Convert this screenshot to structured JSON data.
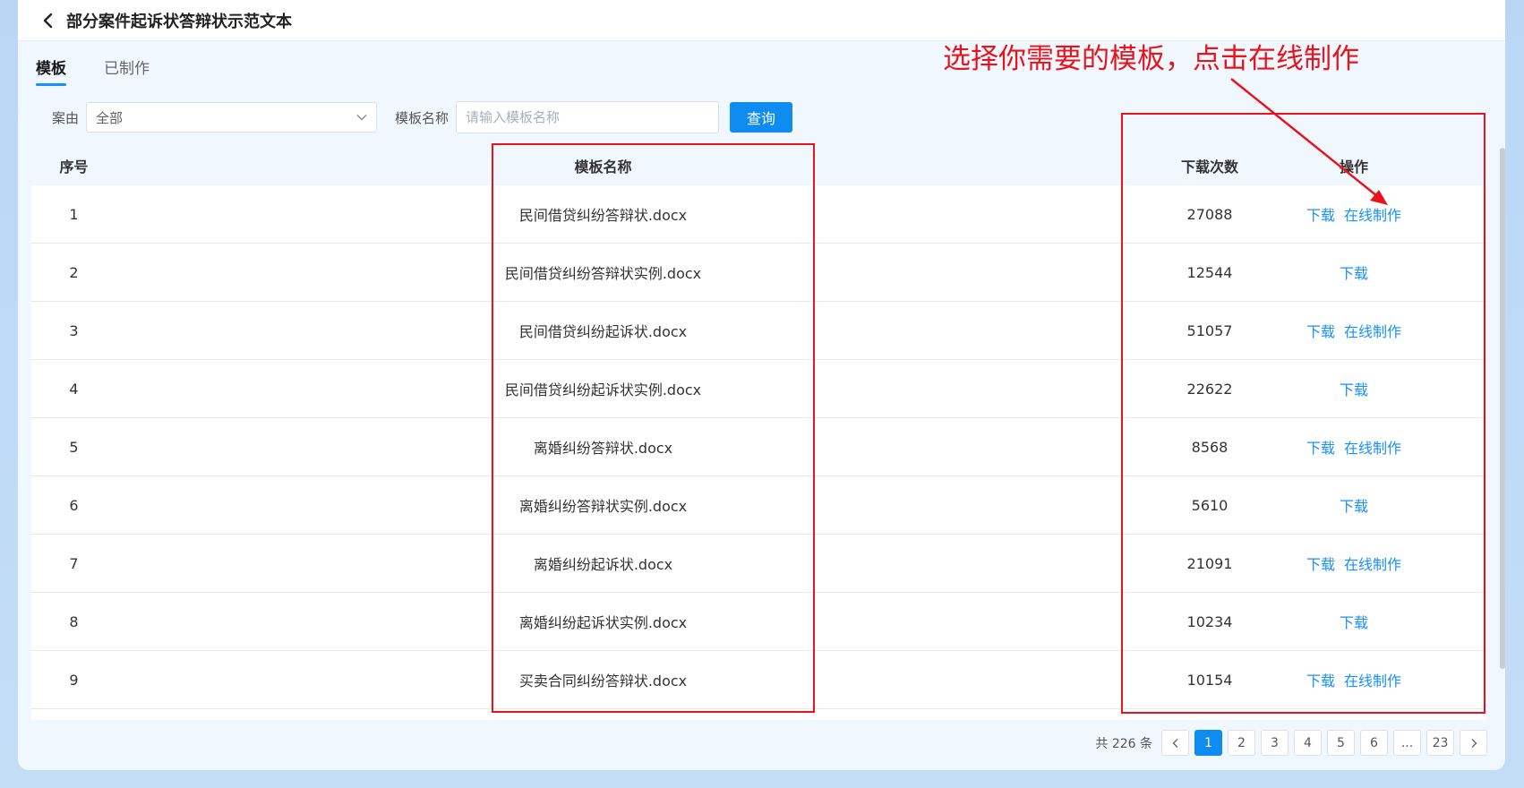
{
  "header": {
    "title": "部分案件起诉状答辩状示范文本"
  },
  "tabs": [
    {
      "label": "模板",
      "active": true
    },
    {
      "label": "已制作",
      "active": false
    }
  ],
  "filters": {
    "case_label": "案由",
    "case_value": "全部",
    "name_label": "模板名称",
    "name_placeholder": "请输入模板名称",
    "query_label": "查询"
  },
  "table": {
    "columns": [
      "序号",
      "模板名称",
      "下载次数",
      "操作"
    ],
    "rows": [
      {
        "index": "1",
        "name": "民间借贷纠纷答辩状.docx",
        "downloads": "27088",
        "actions": [
          "下载",
          "在线制作"
        ]
      },
      {
        "index": "2",
        "name": "民间借贷纠纷答辩状实例.docx",
        "downloads": "12544",
        "actions": [
          "下载"
        ]
      },
      {
        "index": "3",
        "name": "民间借贷纠纷起诉状.docx",
        "downloads": "51057",
        "actions": [
          "下载",
          "在线制作"
        ]
      },
      {
        "index": "4",
        "name": "民间借贷纠纷起诉状实例.docx",
        "downloads": "22622",
        "actions": [
          "下载"
        ]
      },
      {
        "index": "5",
        "name": "离婚纠纷答辩状.docx",
        "downloads": "8568",
        "actions": [
          "下载",
          "在线制作"
        ]
      },
      {
        "index": "6",
        "name": "离婚纠纷答辩状实例.docx",
        "downloads": "5610",
        "actions": [
          "下载"
        ]
      },
      {
        "index": "7",
        "name": "离婚纠纷起诉状.docx",
        "downloads": "21091",
        "actions": [
          "下载",
          "在线制作"
        ]
      },
      {
        "index": "8",
        "name": "离婚纠纷起诉状实例.docx",
        "downloads": "10234",
        "actions": [
          "下载"
        ]
      },
      {
        "index": "9",
        "name": "买卖合同纠纷答辩状.docx",
        "downloads": "10154",
        "actions": [
          "下载",
          "在线制作"
        ]
      }
    ]
  },
  "pagination": {
    "total": "共 226 条",
    "pages": [
      "1",
      "2",
      "3",
      "4",
      "5",
      "6",
      "...",
      "23"
    ],
    "current": "1"
  },
  "annotation": {
    "text": "选择你需要的模板，点击在线制作",
    "color": "#e8141c"
  },
  "colors": {
    "accent": "#1890ff",
    "primary_button": "#0f8cf0",
    "annotation_red": "#e8141c"
  },
  "icons": {
    "back": "chevron-left-icon",
    "dropdown": "chevron-down-icon",
    "prev": "chevron-left-icon",
    "next": "chevron-right-icon"
  }
}
